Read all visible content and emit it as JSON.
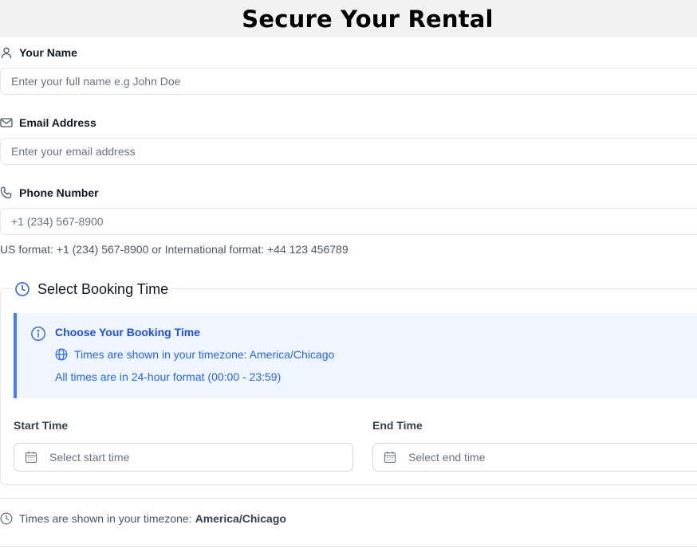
{
  "page": {
    "title": "Secure Your Rental"
  },
  "form": {
    "name": {
      "label": "Your Name",
      "placeholder": "Enter your full name e.g John Doe",
      "icon": "user-icon"
    },
    "email": {
      "label": "Email Address",
      "placeholder": "Enter your email address",
      "icon": "mail-icon"
    },
    "phone": {
      "label": "Phone Number",
      "placeholder": "+1 (234) 567-8900",
      "icon": "phone-icon",
      "hint": "US format: +1 (234) 567-8900 or International format: +44 123 456789"
    }
  },
  "booking": {
    "title": "Select Booking Time",
    "icon": "clock-icon",
    "info": {
      "title": "Choose Your Booking Time",
      "timezone_line": "Times are shown in your timezone: America/Chicago",
      "format_line": "All times are in 24-hour format (00:00 - 23:59)",
      "icon": "info-icon",
      "accent_color": "#3b82f6"
    },
    "start": {
      "label": "Start Time",
      "placeholder": "Select start time",
      "icon": "calendar-icon"
    },
    "end": {
      "label": "End Time",
      "placeholder": "Select end time",
      "icon": "calendar-icon"
    }
  },
  "footer": {
    "prefix": "Times are shown in your timezone:",
    "timezone": "America/Chicago",
    "icon": "clock-icon"
  }
}
